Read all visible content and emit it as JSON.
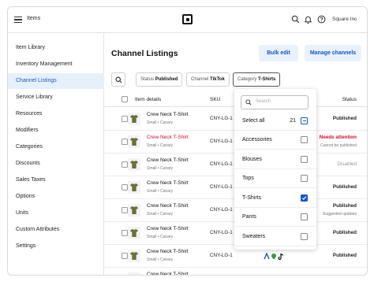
{
  "topbar": {
    "title": "Items",
    "org_name": "Square Inc",
    "icons": [
      "menu-icon",
      "square-logo",
      "search-icon",
      "bell-icon",
      "help-icon"
    ]
  },
  "sidebar": {
    "items": [
      {
        "label": "Item Library"
      },
      {
        "label": "Inventory Management"
      },
      {
        "label": "Channel Listings",
        "active": true
      },
      {
        "label": "Service Library"
      },
      {
        "label": "Resources"
      },
      {
        "label": "Modifiers"
      },
      {
        "label": "Categories"
      },
      {
        "label": "Discounts"
      },
      {
        "label": "Sales Taxes"
      },
      {
        "label": "Options"
      },
      {
        "label": "Units"
      },
      {
        "label": "Custom Attributes"
      },
      {
        "label": "Settings"
      }
    ]
  },
  "main": {
    "title": "Channel Listings",
    "bulk_edit_label": "Bulk edit",
    "manage_channels_label": "Manage channels",
    "filters": {
      "status_label": "Status",
      "status_value": "Published",
      "channel_label": "Channel",
      "channel_value": "TikTok",
      "category_label": "Category",
      "category_value": "T-Shirts"
    },
    "table": {
      "headers": {
        "item": "Item details",
        "sku": "SKU",
        "status": "Status"
      },
      "rows": [
        {
          "name": "Crew Neck T-Shirt",
          "sub": "Small • Canary",
          "sku": "CNY-LG-1",
          "status": "Published",
          "status_sub": "",
          "state": "ok"
        },
        {
          "name": "Crew Neck T-Shirt",
          "sub": "Small • Canary",
          "sku": "CNY-LG-1",
          "status": "Needs attention",
          "status_sub": "Cannot be published",
          "state": "error"
        },
        {
          "name": "Crew Neck T-Shirt",
          "sub": "Small • Canary",
          "sku": "CNY-LG-1",
          "status": "Disabled",
          "status_sub": "",
          "state": "disabled"
        },
        {
          "name": "Crew Neck T-Shirt",
          "sub": "Small • Canary",
          "sku": "CNY-LG-1",
          "status": "Published",
          "status_sub": "",
          "state": "ok"
        },
        {
          "name": "Crew Neck T-Shirt",
          "sub": "Small • Canary",
          "sku": "CNY-LG-1",
          "status": "Published",
          "status_sub": "Suggested updates",
          "state": "ok"
        },
        {
          "name": "Crew Neck T-Shirt",
          "sub": "Small • Canary",
          "sku": "CNY-LG-1",
          "status": "Published",
          "status_sub": "",
          "state": "ok"
        },
        {
          "name": "Crew Neck T-Shirt",
          "sub": "Small • Canary",
          "sku": "CNY-LG-1",
          "status": "Published",
          "status_sub": "",
          "state": "ok"
        },
        {
          "name": "Crew Neck T-Shirt",
          "sub": "",
          "sku": "",
          "status": "",
          "status_sub": "",
          "state": "ok"
        }
      ]
    }
  },
  "dropdown": {
    "search_placeholder": "Search",
    "select_all_label": "Select all",
    "select_all_count": "21",
    "options": [
      {
        "label": "Accessories",
        "checked": false
      },
      {
        "label": "Blouses",
        "checked": false
      },
      {
        "label": "Tops",
        "checked": false
      },
      {
        "label": "T-Shirts",
        "checked": true
      },
      {
        "label": "Pants",
        "checked": false
      },
      {
        "label": "Sweaters",
        "checked": false
      }
    ]
  },
  "colors": {
    "accent": "#1a56c4",
    "active_bg": "#e6f0fb",
    "error": "#c8102e",
    "shirt": "#6b6e3c"
  }
}
